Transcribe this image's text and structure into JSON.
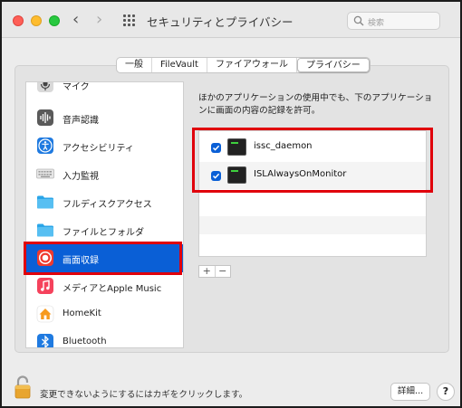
{
  "window": {
    "title": "セキュリティとプライバシー",
    "search_placeholder": "検索",
    "back_glyph": "‹",
    "forward_glyph": "›"
  },
  "tabs": [
    {
      "label": "一般",
      "active": false
    },
    {
      "label": "FileVault",
      "active": false
    },
    {
      "label": "ファイアウォール",
      "active": false
    },
    {
      "label": "プライバシー",
      "active": true
    }
  ],
  "sidebar": {
    "items": [
      {
        "label": "マイク",
        "icon": "microphone-icon"
      },
      {
        "label": "音声認識",
        "icon": "waveform-icon"
      },
      {
        "label": "アクセシビリティ",
        "icon": "accessibility-icon"
      },
      {
        "label": "入力監視",
        "icon": "keyboard-icon"
      },
      {
        "label": "フルディスクアクセス",
        "icon": "folder-icon"
      },
      {
        "label": "ファイルとフォルダ",
        "icon": "folder-icon"
      },
      {
        "label": "画面収録",
        "icon": "screen-record-icon",
        "selected": true
      },
      {
        "label": "メディアとApple Music",
        "icon": "music-icon"
      },
      {
        "label": "HomeKit",
        "icon": "home-icon"
      },
      {
        "label": "Bluetooth",
        "icon": "bluetooth-icon"
      }
    ]
  },
  "main": {
    "description": "ほかのアプリケーションの使用中でも、下のアプリケーションに画面の内容の記録を許可。",
    "apps": [
      {
        "name": "issc_daemon",
        "checked": true,
        "icon": "terminal-icon"
      },
      {
        "name": "ISLAlwaysOnMonitor",
        "checked": true,
        "icon": "terminal-icon"
      }
    ],
    "add_label": "+",
    "remove_label": "−"
  },
  "footer": {
    "lock_text": "変更できないようにするにはカギをクリックします。",
    "details_label": "詳細...",
    "help_label": "?"
  },
  "colors": {
    "accent": "#0a5fd6",
    "highlight": "#e0000b"
  }
}
